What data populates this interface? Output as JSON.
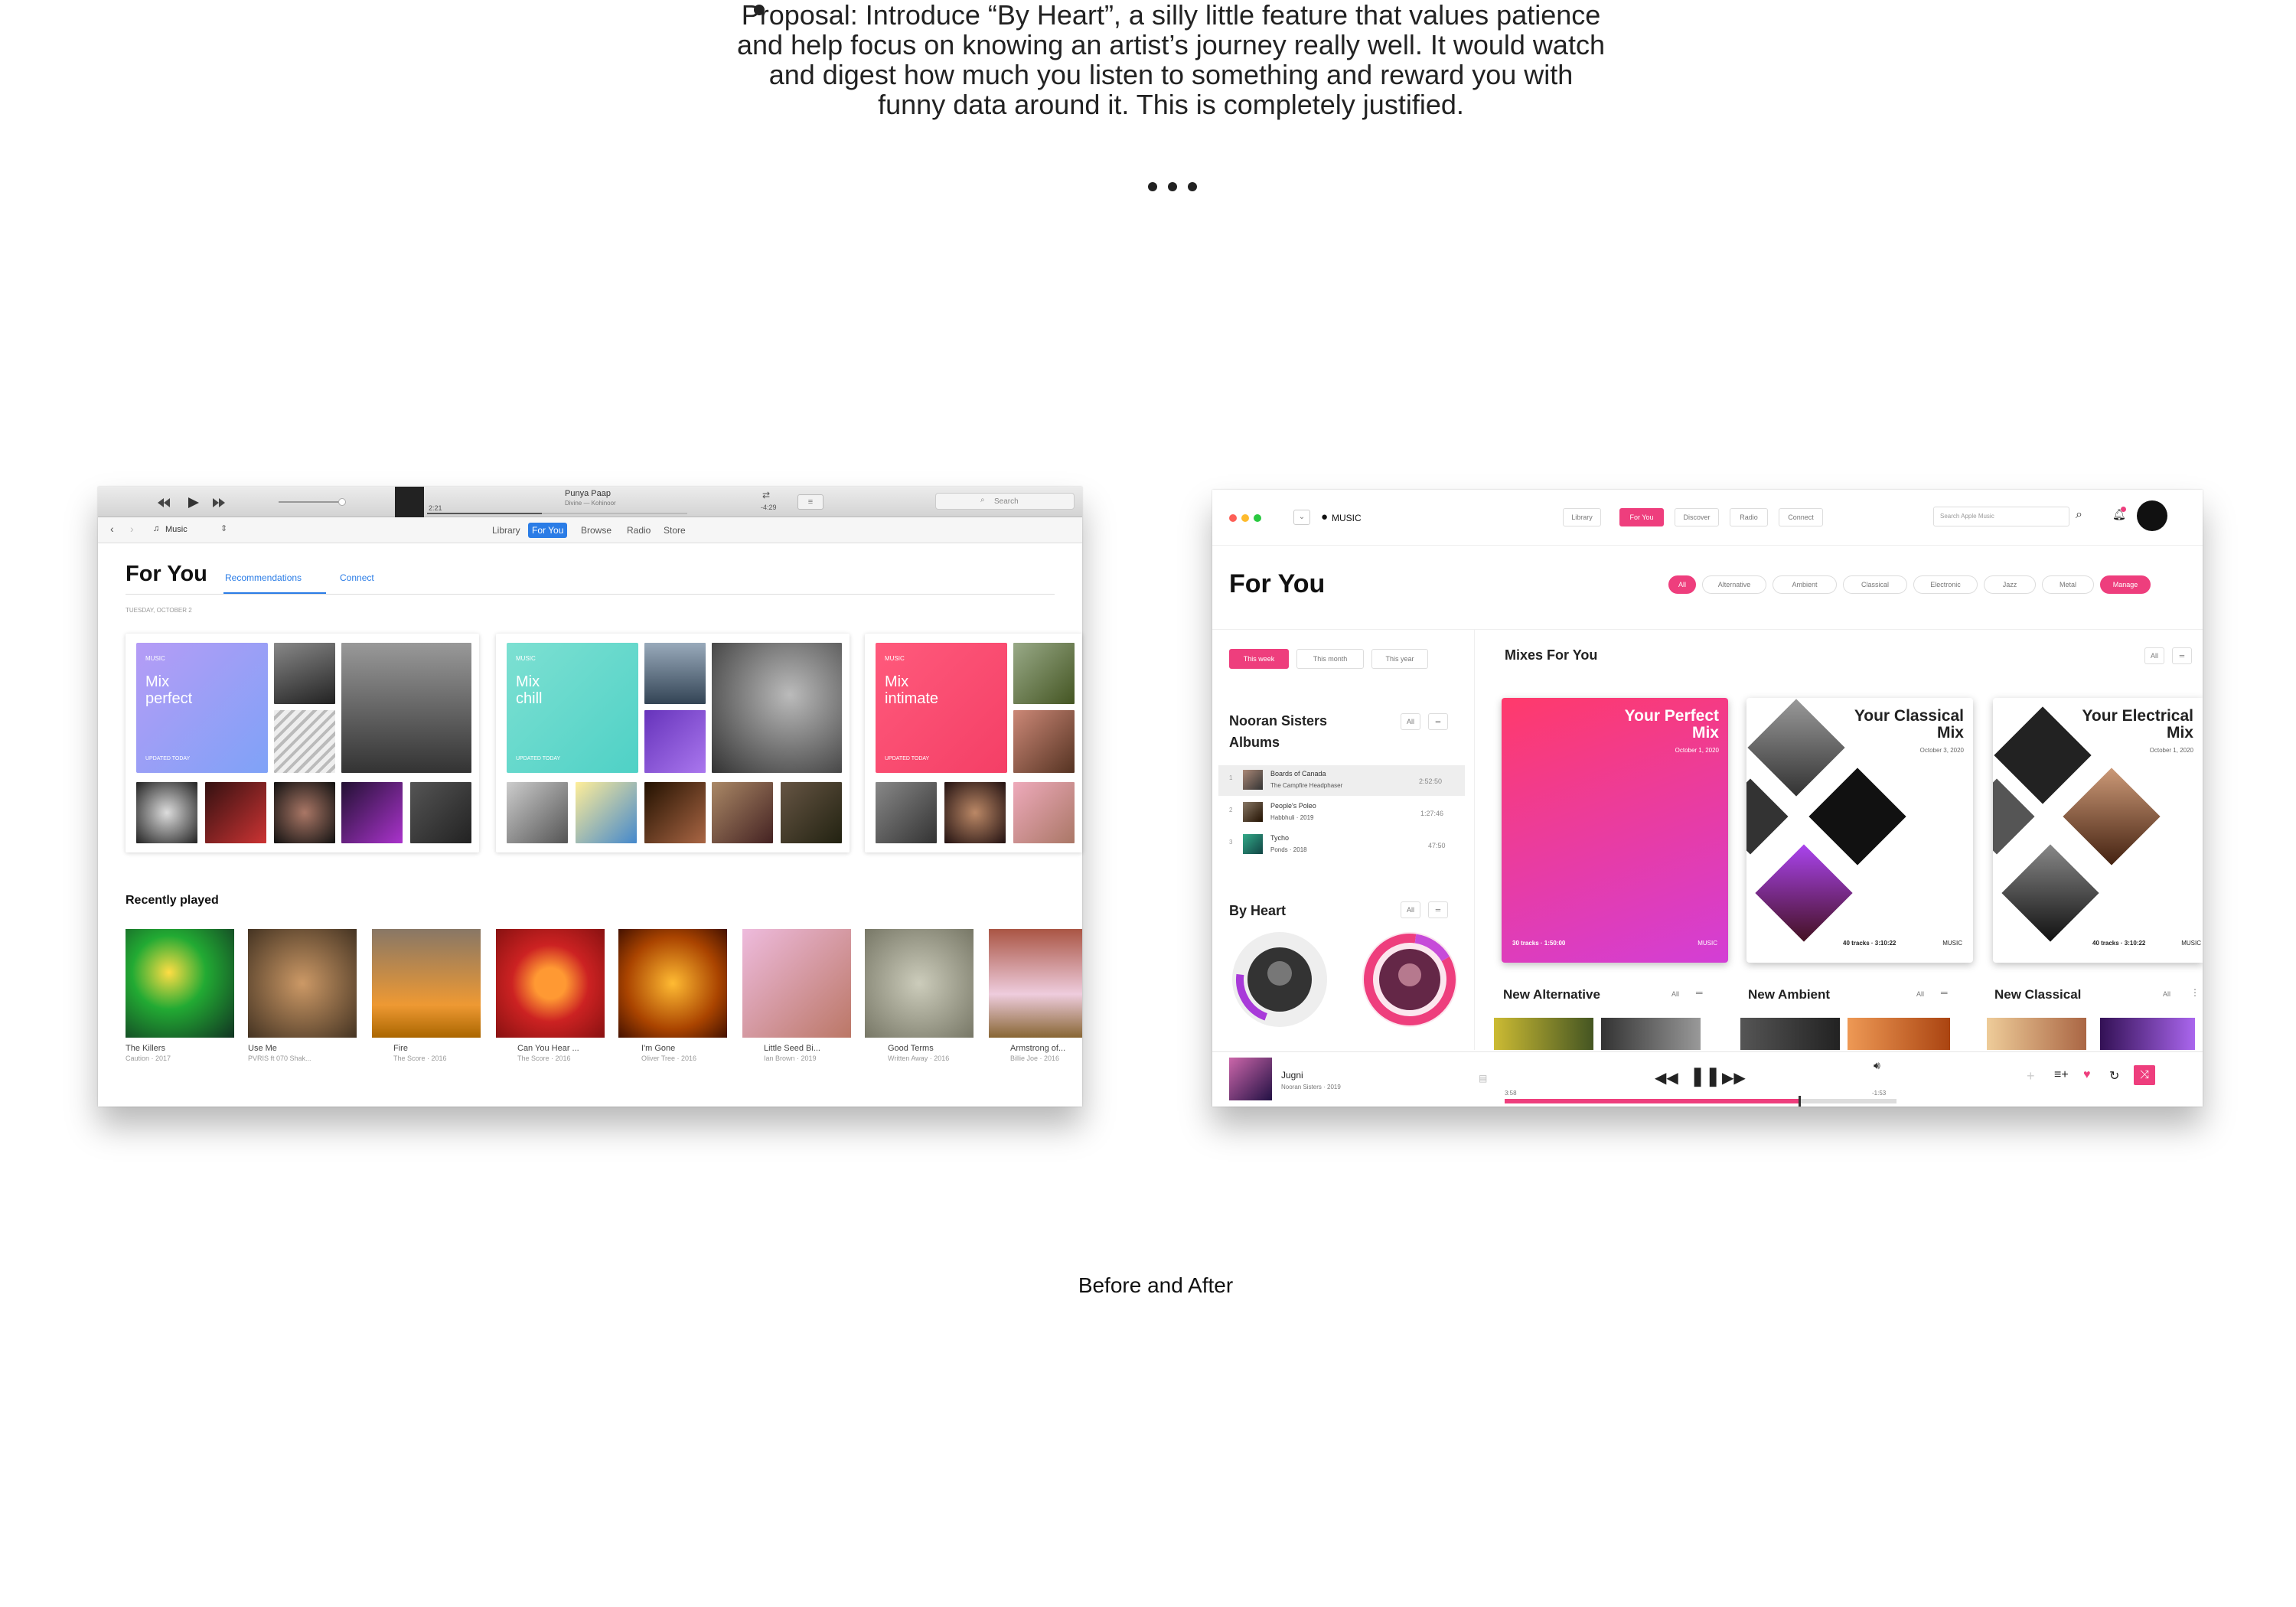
{
  "proposal": {
    "text": "Proposal: Introduce “By Heart”, a silly little feature that values patience and help focus on knowing an artist’s journey really well. It would watch and digest how much you listen to something and reward you with funny data around it. This is completely justified."
  },
  "caption": "Before and After",
  "before": {
    "player": {
      "song": "Punya Paap",
      "artist": "Divine — Kohinoor",
      "elapsed": "2:21",
      "remaining": "-4:29"
    },
    "search_placeholder": "Search",
    "source": "Music",
    "nav": [
      "Library",
      "For You",
      "Browse",
      "Radio",
      "Store"
    ],
    "page_title": "For You",
    "tabs": [
      "Recommendations",
      "Connect"
    ],
    "date": "TUESDAY, OCTOBER 2",
    "mixes": [
      {
        "badge": "MUSIC",
        "line1": "Mix",
        "line2": "perfect",
        "updated": "UPDATED TODAY"
      },
      {
        "badge": "MUSIC",
        "line1": "Mix",
        "line2": "chill",
        "updated": "UPDATED TODAY"
      },
      {
        "badge": "MUSIC",
        "line1": "Mix",
        "line2": "intimate",
        "updated": "UPDATED TODAY"
      }
    ],
    "recent_title": "Recently played",
    "recent": [
      {
        "title": "The Killers",
        "sub": "Caution · 2017"
      },
      {
        "title": "Use Me",
        "sub": "PVRIS ft 070 Shak..."
      },
      {
        "title": "Fire",
        "sub": "The Score · 2016"
      },
      {
        "title": "Can You Hear ...",
        "sub": "The Score · 2016"
      },
      {
        "title": "I'm Gone",
        "sub": "Oliver Tree · 2016"
      },
      {
        "title": "Little Seed Bi...",
        "sub": "Ian Brown · 2019"
      },
      {
        "title": "Good Terms",
        "sub": "Written Away · 2016"
      },
      {
        "title": "Armstrong of...",
        "sub": "Billie Joe · 2016"
      }
    ]
  },
  "after": {
    "brand": "MUSIC",
    "nav": [
      "Library",
      "For You",
      "Discover",
      "Radio",
      "Connect"
    ],
    "search_placeholder": "Search Apple Music",
    "page_title": "For You",
    "genres": [
      "All",
      "Alternative",
      "Ambient",
      "Classical",
      "Electronic",
      "Jazz",
      "Metal"
    ],
    "manage": "Manage",
    "periods": [
      "This week",
      "This month",
      "This year"
    ],
    "albums_title_1": "Nooran Sisters",
    "albums_title_2": "Albums",
    "all": "All",
    "albums": [
      {
        "n": "1",
        "title": "Boards of Canada",
        "sub": "The Campfire Headphaser",
        "time": "2:52:50"
      },
      {
        "n": "2",
        "title": "People's Poleo",
        "sub": "Habbhuli · 2019",
        "time": "1:27:46"
      },
      {
        "n": "3",
        "title": "Tycho",
        "sub": "Ponds · 2018",
        "time": "47:50"
      }
    ],
    "by_heart_title": "By Heart",
    "mixes_title": "Mixes For You",
    "mixes": [
      {
        "title1": "Your Perfect",
        "title2": "Mix",
        "date": "October 1, 2020",
        "info": "30 tracks · 1:50:00",
        "badge": "MUSIC"
      },
      {
        "title1": "Your Classical",
        "title2": "Mix",
        "date": "October 3, 2020",
        "info": "40 tracks · 3:10:22",
        "badge": "MUSIC"
      },
      {
        "title1": "Your Electrical",
        "title2": "Mix",
        "date": "October 1, 2020",
        "info": "40 tracks · 3:10:22",
        "badge": "MUSIC"
      }
    ],
    "new_sections": [
      "New Alternative",
      "New Ambient",
      "New Classical"
    ],
    "now_playing": {
      "title": "Jugni",
      "sub": "Nooran Sisters · 2019",
      "elapsed": "3:58",
      "remaining": "-1:53"
    },
    "colors": {
      "accent": "#ee3e7d"
    }
  }
}
